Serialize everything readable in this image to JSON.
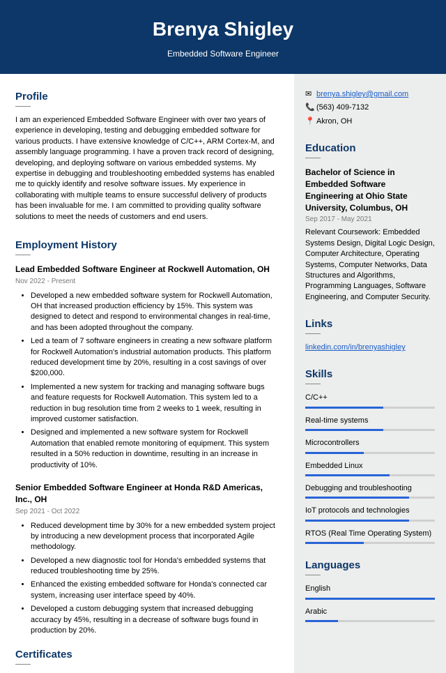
{
  "header": {
    "name": "Brenya Shigley",
    "role": "Embedded Software Engineer"
  },
  "profile": {
    "title": "Profile",
    "text": "I am an experienced Embedded Software Engineer with over two years of experience in developing, testing and debugging embedded software for various products. I have extensive knowledge of C/C++, ARM Cortex-M, and assembly language programming. I have a proven track record of designing, developing, and deploying software on various embedded systems. My expertise in debugging and troubleshooting embedded systems has enabled me to quickly identify and resolve software issues. My experience in collaborating with multiple teams to ensure successful delivery of products has been invaluable for me. I am committed to providing quality software solutions to meet the needs of customers and end users."
  },
  "employment": {
    "title": "Employment History",
    "jobs": [
      {
        "title": "Lead Embedded Software Engineer at Rockwell Automation, OH",
        "dates": "Nov 2022 - Present",
        "bullets": [
          "Developed a new embedded software system for Rockwell Automation, OH that increased production efficiency by 15%. This system was designed to detect and respond to environmental changes in real-time, and has been adopted throughout the company.",
          "Led a team of 7 software engineers in creating a new software platform for Rockwell Automation's industrial automation products. This platform reduced development time by 20%, resulting in a cost savings of over $200,000.",
          "Implemented a new system for tracking and managing software bugs and feature requests for Rockwell Automation. This system led to a reduction in bug resolution time from 2 weeks to 1 week, resulting in improved customer satisfaction.",
          "Designed and implemented a new software system for Rockwell Automation that enabled remote monitoring of equipment. This system resulted in a 50% reduction in downtime, resulting in an increase in productivity of 10%."
        ]
      },
      {
        "title": "Senior Embedded Software Engineer at Honda R&D Americas, Inc., OH",
        "dates": "Sep 2021 - Oct 2022",
        "bullets": [
          "Reduced development time by 30% for a new embedded system project by introducing a new development process that incorporated Agile methodology.",
          "Developed a new diagnostic tool for Honda's embedded systems that reduced troubleshooting time by 25%.",
          "Enhanced the existing embedded software for Honda's connected car system, increasing user interface speed by 40%.",
          "Developed a custom debugging system that increased debugging accuracy by 45%, resulting in a decrease of software bugs found in production by 20%."
        ]
      }
    ]
  },
  "certificates": {
    "title": "Certificates"
  },
  "contact": {
    "email": "brenya.shigley@gmail.com",
    "phone": "(563) 409-7132",
    "location": "Akron, OH"
  },
  "education": {
    "title": "Education",
    "degree": "Bachelor of Science in Embedded Software Engineering at Ohio State University, Columbus, OH",
    "dates": "Sep 2017 - May 2021",
    "text": "Relevant Coursework: Embedded Systems Design, Digital Logic Design, Computer Architecture, Operating Systems, Computer Networks, Data Structures and Algorithms, Programming Languages, Software Engineering, and Computer Security."
  },
  "links": {
    "title": "Links",
    "url": "linkedin.com/in/brenyashigley"
  },
  "skills": {
    "title": "Skills",
    "items": [
      {
        "name": "C/C++",
        "level": 60
      },
      {
        "name": "Real-time systems",
        "level": 60
      },
      {
        "name": "Microcontrollers",
        "level": 45
      },
      {
        "name": "Embedded Linux",
        "level": 65
      },
      {
        "name": "Debugging and troubleshooting",
        "level": 80
      },
      {
        "name": "IoT protocols and technologies",
        "level": 80
      },
      {
        "name": "RTOS (Real Time Operating System)",
        "level": 45
      }
    ]
  },
  "languages": {
    "title": "Languages",
    "items": [
      {
        "name": "English",
        "level": 100
      },
      {
        "name": "Arabic",
        "level": 25
      }
    ]
  }
}
